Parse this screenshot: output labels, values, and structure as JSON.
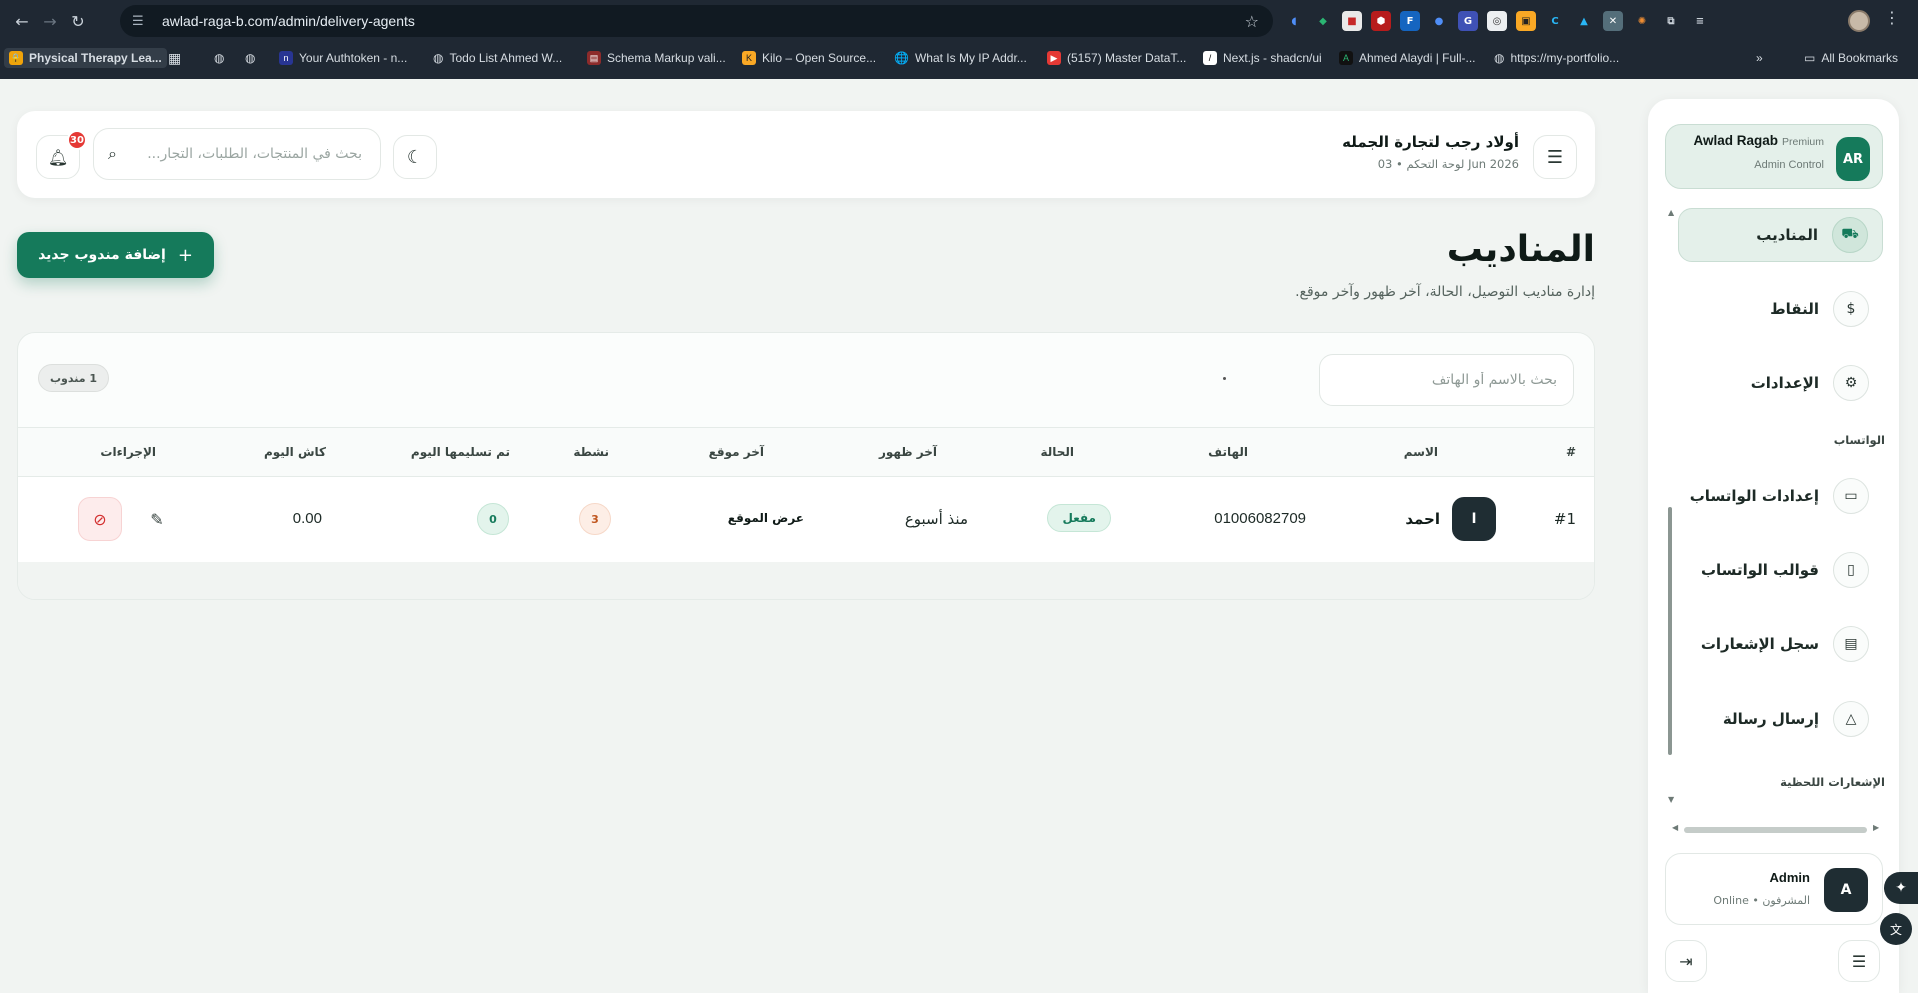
{
  "browser": {
    "url": "awlad-raga-b.com/admin/delivery-agents",
    "bookmarks": [
      {
        "label": "Physical Therapy Lea..."
      },
      {
        "label": "Your Authtoken - n..."
      },
      {
        "label": "Todo List Ahmed W..."
      },
      {
        "label": "Schema Markup vali..."
      },
      {
        "label": "Kilo – Open Source..."
      },
      {
        "label": "What Is My IP Addr..."
      },
      {
        "label": "(5157) Master DataT..."
      },
      {
        "label": "Next.js - shadcn/ui"
      },
      {
        "label": "Ahmed Alaydi | Full-..."
      },
      {
        "label": "https://my-portfolio..."
      }
    ],
    "all_bookmarks": "All Bookmarks"
  },
  "header": {
    "brand_title": "أولاد رجب لتجارة الجمله",
    "brand_sub": "لوحة التحكم • 03 Jun 2026",
    "search_placeholder": "بحث في المنتجات، الطلبات، التجار...",
    "notification_count": "30"
  },
  "page": {
    "title": "المناديب",
    "description": "إدارة مناديب التوصيل، الحالة، آخر ظهور وآخر موقع.",
    "add_button": "إضافة مندوب جديد"
  },
  "table": {
    "search_placeholder": "بحث بالاسم أو الهاتف",
    "count_badge": "1 مندوب",
    "headers": {
      "index": "#",
      "name": "الاسم",
      "phone": "الهاتف",
      "status": "الحالة",
      "last_seen": "آخر ظهور",
      "last_location": "آخر موقع",
      "active": "نشطة",
      "delivered_today": "تم تسليمها اليوم",
      "cash_today": "كاش اليوم",
      "actions": "الإجراءات"
    },
    "rows": [
      {
        "index": "#1",
        "avatar": "ا",
        "name": "احمد",
        "phone": "01006082709",
        "status": "مفعل",
        "last_seen": "منذ أسبوع",
        "last_location": "عرض الموقع",
        "active": "3",
        "delivered_today": "0",
        "cash_today": "0.00"
      }
    ]
  },
  "sidebar": {
    "profile": {
      "avatar": "AR",
      "name": "Awlad Ragab",
      "plan": "Premium",
      "role": "Admin Control"
    },
    "items": [
      {
        "label": "المناديب",
        "icon": "truck-icon"
      },
      {
        "label": "النقاط",
        "icon": "coin-icon"
      },
      {
        "label": "الإعدادات",
        "icon": "gear-icon"
      }
    ],
    "section_whatsapp": "الواتساب",
    "whatsapp_items": [
      {
        "label": "إعدادات الواتساب",
        "icon": "chat-icon"
      },
      {
        "label": "قوالب الواتساب",
        "icon": "document-icon"
      },
      {
        "label": "سجل الإشعارات",
        "icon": "clipboard-icon"
      },
      {
        "label": "إرسال رسالة",
        "icon": "warning-icon"
      }
    ],
    "section_instant": "الإشعارات اللحظية",
    "admin": {
      "avatar": "A",
      "name": "Admin",
      "sub": "المشرفون • Online"
    }
  }
}
